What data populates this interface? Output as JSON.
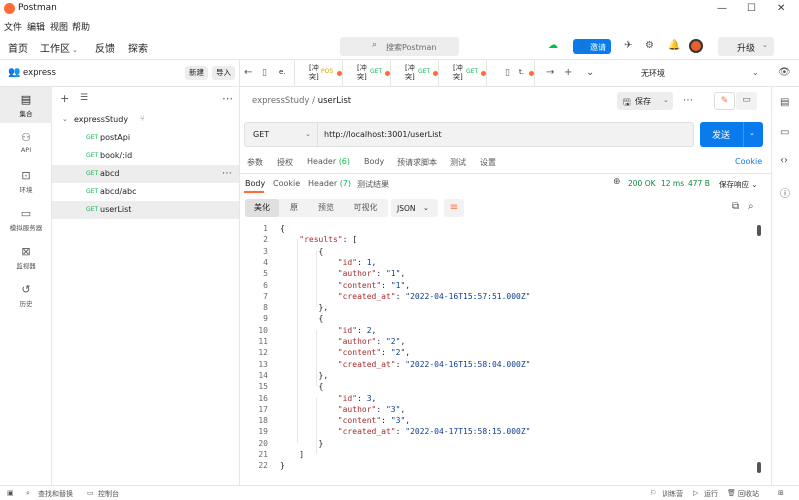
{
  "app": {
    "title": "Postman",
    "brand_color": "#ff6c37",
    "accent_color": "#097bed"
  },
  "menu": [
    "文件",
    "编辑",
    "视图",
    "帮助"
  ],
  "topnav": {
    "home": "首页",
    "workspace": "工作区",
    "feedback": "反馈",
    "explore": "探索",
    "search_placeholder": "搜索Postman",
    "invite": "邀请",
    "upgrade": "升级"
  },
  "workspace": {
    "name": "express",
    "new_btn": "新建",
    "import_btn": "导入"
  },
  "rail": [
    {
      "label": "集合",
      "icon": "collection-icon",
      "glyph": "▤"
    },
    {
      "label": "API",
      "icon": "api-icon",
      "glyph": "⚇"
    },
    {
      "label": "环境",
      "icon": "environment-icon",
      "glyph": "⊡"
    },
    {
      "label": "模拟服务器",
      "icon": "mock-server-icon",
      "glyph": "▭"
    },
    {
      "label": "监视器",
      "icon": "monitor-icon",
      "glyph": "⊠"
    },
    {
      "label": "历史",
      "icon": "history-icon",
      "glyph": "↺"
    }
  ],
  "collection": {
    "name": "expressStudy",
    "requests": [
      {
        "method": "GET",
        "name": "postApi"
      },
      {
        "method": "GET",
        "name": "book/:id"
      },
      {
        "method": "GET",
        "name": "abcd"
      },
      {
        "method": "GET",
        "name": "abcd/abc"
      },
      {
        "method": "GET",
        "name": "userList"
      }
    ]
  },
  "tabs": [
    {
      "method": "",
      "name": "e."
    },
    {
      "method": "POS",
      "name": "[冲突]"
    },
    {
      "method": "GET",
      "name": "[冲突]"
    },
    {
      "method": "GET",
      "name": "[冲突]"
    },
    {
      "method": "GET",
      "name": "[冲突]"
    },
    {
      "method": "",
      "name": "t."
    }
  ],
  "environment": "无环境",
  "request": {
    "breadcrumb_parent": "expressStudy",
    "breadcrumb_sep": "/",
    "breadcrumb_name": "userList",
    "save": "保存",
    "method": "GET",
    "url": "http://localhost:3001/userList",
    "send": "发送",
    "tabs": {
      "params": "参数",
      "auth": "授权",
      "headers": "Header",
      "headers_count": "(6)",
      "body": "Body",
      "prerequest": "预请求脚本",
      "tests": "测试",
      "settings": "设置"
    },
    "cookies": "Cookie"
  },
  "response": {
    "tabs": {
      "body": "Body",
      "cookie": "Cookie",
      "headers": "Header",
      "headers_count": "(7)",
      "results": "测试结果"
    },
    "status": "200 OK",
    "time": "12 ms",
    "size": "477 B",
    "save": "保存响应",
    "formats": [
      "美化",
      "原",
      "预览",
      "可视化"
    ],
    "format_type": "JSON"
  },
  "code_lines": [
    "{",
    "    \"results\": [",
    "        {",
    "            \"id\": 1,",
    "            \"author\": \"1\",",
    "            \"content\": \"1\",",
    "            \"created_at\": \"2022-04-16T15:57:51.000Z\"",
    "        },",
    "        {",
    "            \"id\": 2,",
    "            \"author\": \"2\",",
    "            \"content\": \"2\",",
    "            \"created_at\": \"2022-04-16T15:58:04.000Z\"",
    "        },",
    "        {",
    "            \"id\": 3,",
    "            \"author\": \"3\",",
    "            \"content\": \"3\",",
    "            \"created_at\": \"2022-04-17T15:58:15.000Z\"",
    "        }",
    "    ]",
    "}"
  ],
  "statusbar": {
    "find": "查找和替换",
    "console": "控制台",
    "bootcamp": "训练营",
    "runner": "运行",
    "trash": "回收站"
  }
}
